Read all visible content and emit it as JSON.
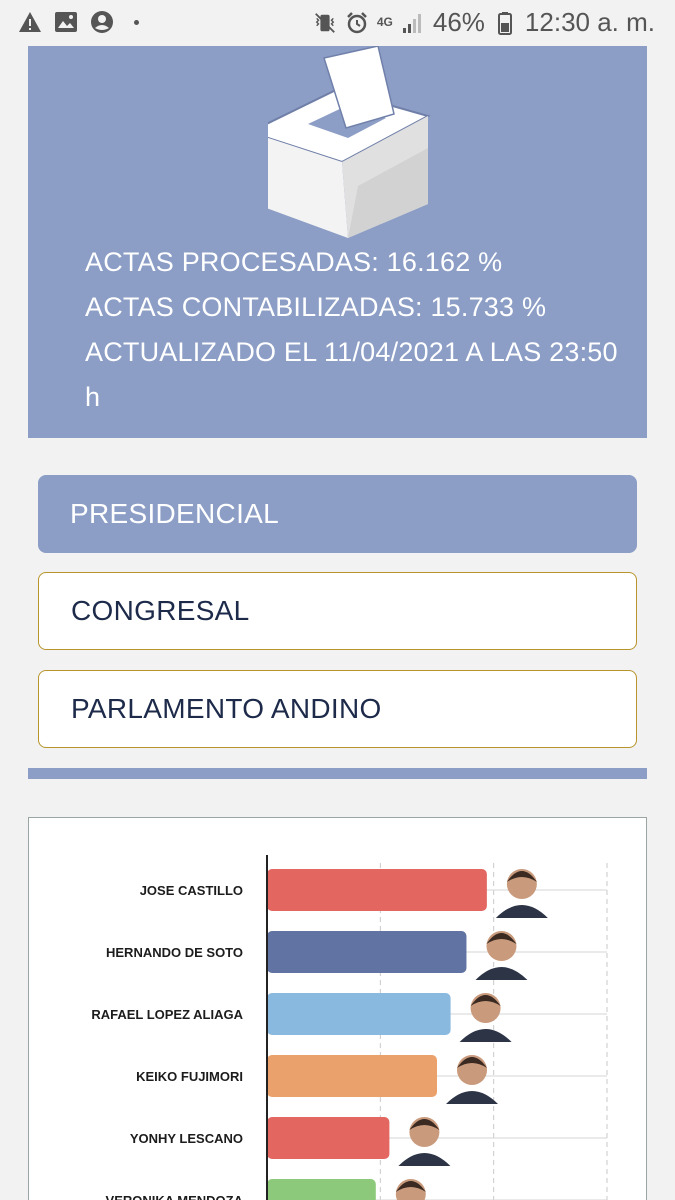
{
  "status_bar": {
    "left_icons": [
      "warning-icon",
      "image-icon",
      "account-icon"
    ],
    "network": "4G",
    "battery_percent": "46%",
    "time": "12:30 a. m."
  },
  "hero": {
    "actas_procesadas": "ACTAS PROCESADAS: 16.162 %",
    "actas_contabilizadas": "ACTAS CONTABILIZADAS: 15.733 %",
    "actualizado": "ACTUALIZADO EL 11/04/2021 A LAS 23:50 h"
  },
  "tabs": [
    {
      "label": "PRESIDENCIAL",
      "active": true
    },
    {
      "label": "CONGRESAL",
      "active": false
    },
    {
      "label": "PARLAMENTO ANDINO",
      "active": false
    }
  ],
  "colors": {
    "accent": "#8c9ec6",
    "tab_border": "#b8952c"
  },
  "chart_data": {
    "type": "bar",
    "orientation": "horizontal",
    "categories": [
      "JOSE CASTILLO",
      "HERNANDO DE SOTO",
      "RAFAEL LOPEZ ALIAGA",
      "KEIKO FUJIMORI",
      "YONHY LESCANO",
      "VERONIKA MENDOZA"
    ],
    "values": [
      97,
      88,
      81,
      75,
      54,
      48
    ],
    "colors": [
      "#e46661",
      "#6073a3",
      "#8ab9e0",
      "#eba16b",
      "#e46661",
      "#8cc97a"
    ],
    "xlim": [
      0,
      150
    ],
    "grid": true,
    "legend": "none"
  }
}
